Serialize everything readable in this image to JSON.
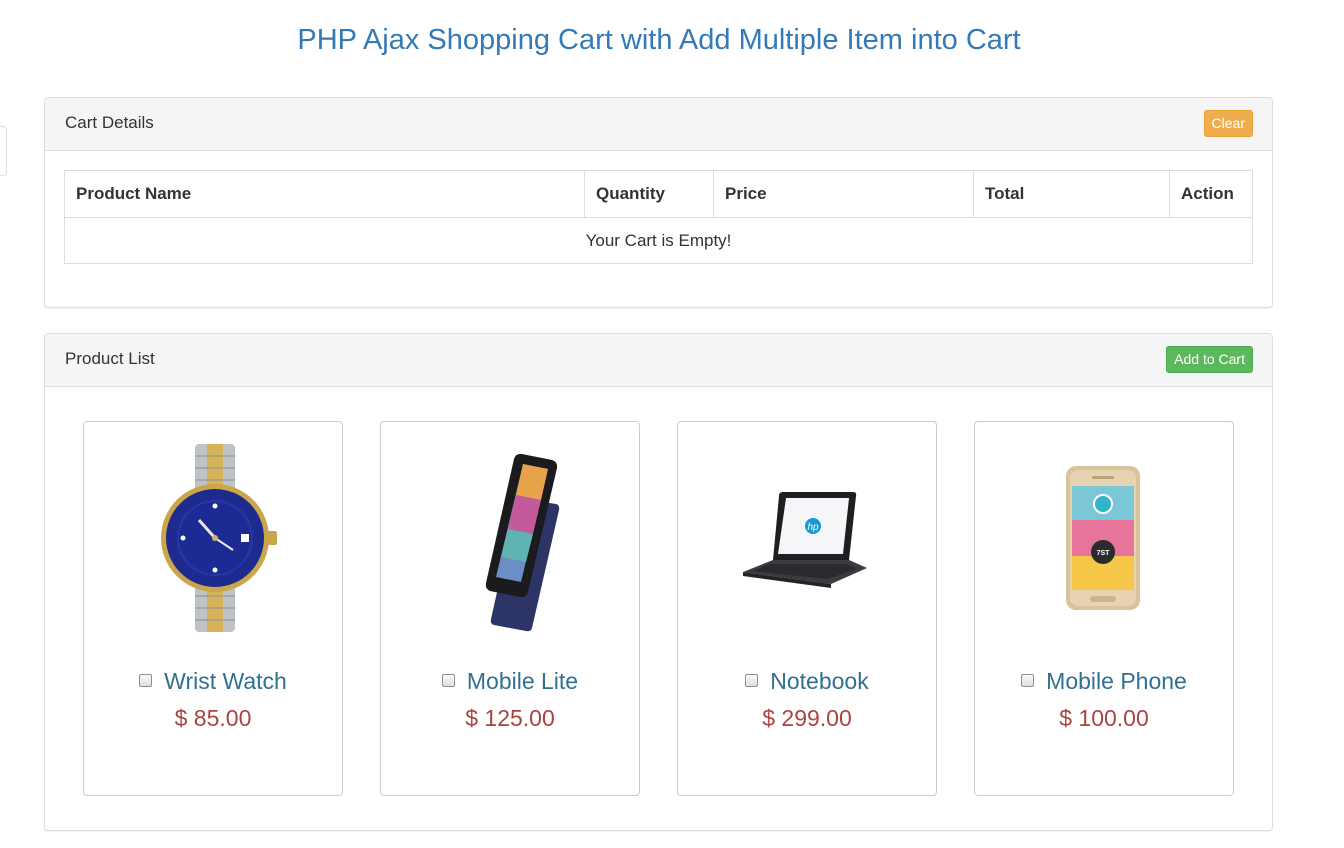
{
  "page": {
    "title": "PHP Ajax Shopping Cart with Add Multiple Item into Cart"
  },
  "cart": {
    "heading": "Cart Details",
    "clear_label": "Clear",
    "columns": [
      "Product Name",
      "Quantity",
      "Price",
      "Total",
      "Action"
    ],
    "empty_message": "Your Cart is Empty!"
  },
  "products": {
    "heading": "Product List",
    "add_label": "Add to Cart",
    "items": [
      {
        "name": "Wrist Watch",
        "price": "$ 85.00",
        "image": "wrist-watch-image",
        "checked": false
      },
      {
        "name": "Mobile Lite",
        "price": "$ 125.00",
        "image": "mobile-lite-image",
        "checked": false
      },
      {
        "name": "Notebook",
        "price": "$ 299.00",
        "image": "notebook-image",
        "checked": false
      },
      {
        "name": "Mobile Phone",
        "price": "$ 100.00",
        "image": "mobile-phone-image",
        "checked": false
      }
    ]
  },
  "colors": {
    "title": "#337ab7",
    "clear_button": "#f0ad4e",
    "add_button": "#5cb85c",
    "product_name": "#31708f",
    "product_price": "#a94442"
  }
}
